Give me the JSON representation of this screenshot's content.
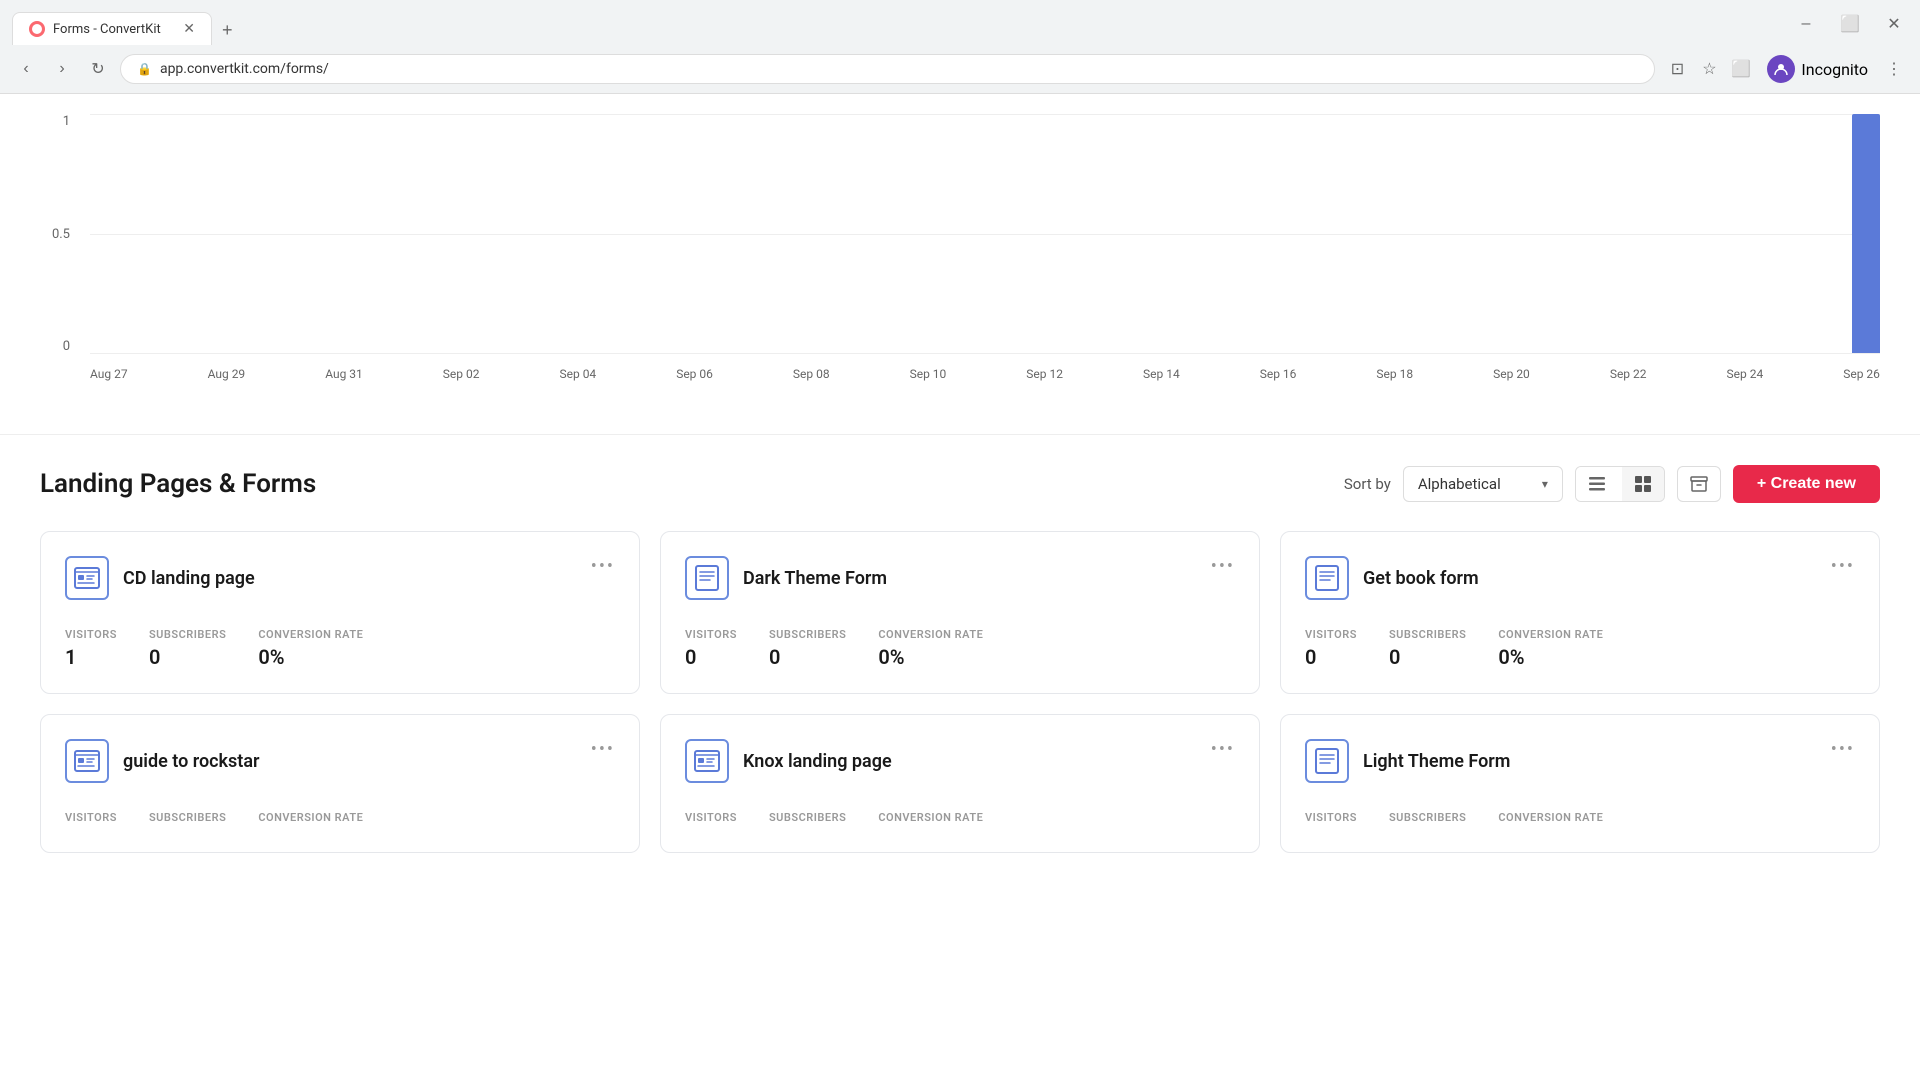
{
  "browser": {
    "tab_title": "Forms - ConvertKit",
    "tab_favicon": "FK",
    "url": "app.convertkit.com/forms/",
    "incognito_label": "Incognito"
  },
  "chart": {
    "y_labels": [
      "1",
      "0.5",
      "0"
    ],
    "x_labels": [
      "Aug 27",
      "Aug 29",
      "Aug 31",
      "Sep 02",
      "Sep 04",
      "Sep 06",
      "Sep 08",
      "Sep 10",
      "Sep 12",
      "Sep 14",
      "Sep 16",
      "Sep 18",
      "Sep 20",
      "Sep 22",
      "Sep 24",
      "Sep 26"
    ],
    "bar_height_percent": 100,
    "bar_color": "#5b7ad8"
  },
  "section": {
    "title": "Landing Pages & Forms",
    "sort_label": "Sort by",
    "sort_value": "Alphabetical",
    "create_new_label": "+ Create new",
    "create_icon": "+"
  },
  "cards": [
    {
      "id": "cd-landing-page",
      "title": "CD landing page",
      "type": "landing",
      "visitors": "1",
      "subscribers": "0",
      "conversion_rate": "0%",
      "visitors_label": "VISITORS",
      "subscribers_label": "SUBSCRIBERS",
      "conversion_label": "CONVERSION RATE"
    },
    {
      "id": "dark-theme-form",
      "title": "Dark Theme Form",
      "type": "form",
      "visitors": "0",
      "subscribers": "0",
      "conversion_rate": "0%",
      "visitors_label": "VISITORS",
      "subscribers_label": "SUBSCRIBERS",
      "conversion_label": "CONVERSION RATE"
    },
    {
      "id": "get-book-form",
      "title": "Get book form",
      "type": "form",
      "visitors": "0",
      "subscribers": "0",
      "conversion_rate": "0%",
      "visitors_label": "VISITORS",
      "subscribers_label": "SUBSCRIBERS",
      "conversion_label": "CONVERSION RATE"
    },
    {
      "id": "guide-to-rockstar",
      "title": "guide to rockstar",
      "type": "landing",
      "visitors": "",
      "subscribers": "",
      "conversion_rate": "",
      "visitors_label": "VISITORS",
      "subscribers_label": "SUBSCRIBERS",
      "conversion_label": "CONVERSION RATE"
    },
    {
      "id": "knox-landing-page",
      "title": "Knox landing page",
      "type": "landing",
      "visitors": "",
      "subscribers": "",
      "conversion_rate": "",
      "visitors_label": "VISITORS",
      "subscribers_label": "SUBSCRIBERS",
      "conversion_label": "CONVERSION RATE"
    },
    {
      "id": "light-theme-form",
      "title": "Light Theme Form",
      "type": "form",
      "visitors": "",
      "subscribers": "",
      "conversion_rate": "",
      "visitors_label": "VISITORS",
      "subscribers_label": "SUBSCRIBERS",
      "conversion_label": "CONVERSION RATE"
    }
  ]
}
